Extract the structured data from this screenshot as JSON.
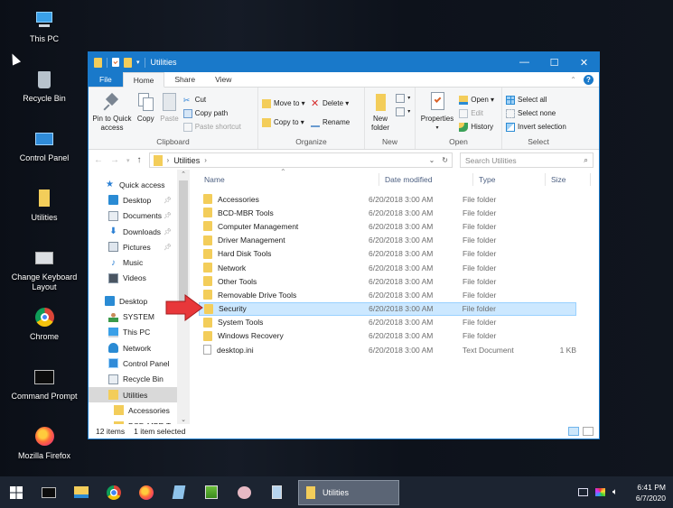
{
  "desktop": {
    "icons": [
      {
        "label": "This PC",
        "icon": "this-pc-icon"
      },
      {
        "label": "Recycle Bin",
        "icon": "recycle-bin-icon"
      },
      {
        "label": "Control Panel",
        "icon": "control-panel-icon"
      },
      {
        "label": "Utilities",
        "icon": "folder-icon"
      },
      {
        "label": "Change Keyboard Layout",
        "icon": "keyboard-layout-icon"
      },
      {
        "label": "Chrome",
        "icon": "chrome-icon"
      },
      {
        "label": "Command Prompt",
        "icon": "command-prompt-icon"
      },
      {
        "label": "Mozilla Firefox",
        "icon": "firefox-icon"
      }
    ]
  },
  "window": {
    "title": "Utilities",
    "controls": {
      "minimize": "—",
      "maximize": "☐",
      "close": "✕"
    },
    "tabs": [
      "File",
      "Home",
      "Share",
      "View"
    ],
    "active_tab": "Home",
    "ribbon": {
      "clipboard": {
        "pin": "Pin to Quick access",
        "copy": "Copy",
        "paste": "Paste",
        "cut": "Cut",
        "copy_path": "Copy path",
        "paste_shortcut": "Paste shortcut",
        "label": "Clipboard"
      },
      "organize": {
        "move_to": "Move to ▾",
        "copy_to": "Copy to ▾",
        "delete": "Delete ▾",
        "rename": "Rename",
        "label": "Organize"
      },
      "new": {
        "new_folder": "New folder",
        "label": "New"
      },
      "open": {
        "properties": "Properties",
        "open": "Open ▾",
        "edit": "Edit",
        "history": "History",
        "label": "Open"
      },
      "select": {
        "select_all": "Select all",
        "select_none": "Select none",
        "invert": "Invert selection",
        "label": "Select"
      }
    },
    "address": {
      "path": [
        "Utilities"
      ],
      "search_placeholder": "Search Utilities"
    },
    "nav": [
      {
        "label": "Quick access",
        "icon": "star-icon",
        "level": "top",
        "pinned": false
      },
      {
        "label": "Desktop",
        "icon": "desktop-icon",
        "level": "item",
        "pinned": true
      },
      {
        "label": "Documents",
        "icon": "documents-icon",
        "level": "item",
        "pinned": true
      },
      {
        "label": "Downloads",
        "icon": "downloads-icon",
        "level": "item",
        "pinned": true
      },
      {
        "label": "Pictures",
        "icon": "pictures-icon",
        "level": "item",
        "pinned": true
      },
      {
        "label": "Music",
        "icon": "music-icon",
        "level": "item",
        "pinned": false
      },
      {
        "label": "Videos",
        "icon": "videos-icon",
        "level": "item",
        "pinned": false
      },
      {
        "label": "Desktop",
        "icon": "desktop-icon",
        "level": "top",
        "pinned": false
      },
      {
        "label": "SYSTEM",
        "icon": "user-icon",
        "level": "item",
        "pinned": false
      },
      {
        "label": "This PC",
        "icon": "this-pc-icon",
        "level": "item",
        "pinned": false
      },
      {
        "label": "Network",
        "icon": "network-icon",
        "level": "item",
        "pinned": false
      },
      {
        "label": "Control Panel",
        "icon": "control-panel-icon",
        "level": "item",
        "pinned": false
      },
      {
        "label": "Recycle Bin",
        "icon": "recycle-bin-icon",
        "level": "item",
        "pinned": false
      },
      {
        "label": "Utilities",
        "icon": "folder-icon",
        "level": "item",
        "pinned": false,
        "selected": true
      },
      {
        "label": "Accessories",
        "icon": "folder-icon",
        "level": "sub",
        "pinned": false
      },
      {
        "label": "BCD-MBR Tools",
        "icon": "folder-icon",
        "level": "sub",
        "pinned": false
      }
    ],
    "columns": {
      "name": "Name",
      "date": "Date modified",
      "type": "Type",
      "size": "Size"
    },
    "files": [
      {
        "name": "Accessories",
        "date": "6/20/2018 3:00 AM",
        "type": "File folder",
        "size": "",
        "kind": "folder"
      },
      {
        "name": "BCD-MBR Tools",
        "date": "6/20/2018 3:00 AM",
        "type": "File folder",
        "size": "",
        "kind": "folder"
      },
      {
        "name": "Computer Management",
        "date": "6/20/2018 3:00 AM",
        "type": "File folder",
        "size": "",
        "kind": "folder"
      },
      {
        "name": "Driver Management",
        "date": "6/20/2018 3:00 AM",
        "type": "File folder",
        "size": "",
        "kind": "folder"
      },
      {
        "name": "Hard Disk Tools",
        "date": "6/20/2018 3:00 AM",
        "type": "File folder",
        "size": "",
        "kind": "folder"
      },
      {
        "name": "Network",
        "date": "6/20/2018 3:00 AM",
        "type": "File folder",
        "size": "",
        "kind": "folder"
      },
      {
        "name": "Other Tools",
        "date": "6/20/2018 3:00 AM",
        "type": "File folder",
        "size": "",
        "kind": "folder"
      },
      {
        "name": "Removable Drive Tools",
        "date": "6/20/2018 3:00 AM",
        "type": "File folder",
        "size": "",
        "kind": "folder"
      },
      {
        "name": "Security",
        "date": "6/20/2018 3:00 AM",
        "type": "File folder",
        "size": "",
        "kind": "folder",
        "selected": true
      },
      {
        "name": "System Tools",
        "date": "6/20/2018 3:00 AM",
        "type": "File folder",
        "size": "",
        "kind": "folder"
      },
      {
        "name": "Windows Recovery",
        "date": "6/20/2018 3:00 AM",
        "type": "File folder",
        "size": "",
        "kind": "folder"
      },
      {
        "name": "desktop.ini",
        "date": "6/20/2018 3:00 AM",
        "type": "Text Document",
        "size": "1 KB",
        "kind": "file"
      }
    ],
    "status": {
      "count": "12 items",
      "selection": "1 item selected"
    }
  },
  "taskbar": {
    "pinned": [
      "start-icon",
      "command-prompt-icon",
      "file-explorer-icon",
      "chrome-icon",
      "firefox-icon",
      "notepad-icon",
      "image-editor-icon",
      "paint-icon",
      "calculator-icon"
    ],
    "task_label": "Utilities",
    "clock_time": "6:41 PM",
    "clock_date": "6/7/2020"
  },
  "colors": {
    "accent": "#1979ca",
    "selection": "#cce8ff",
    "arrow": "#e8373a",
    "folder": "#f3cd5a"
  }
}
